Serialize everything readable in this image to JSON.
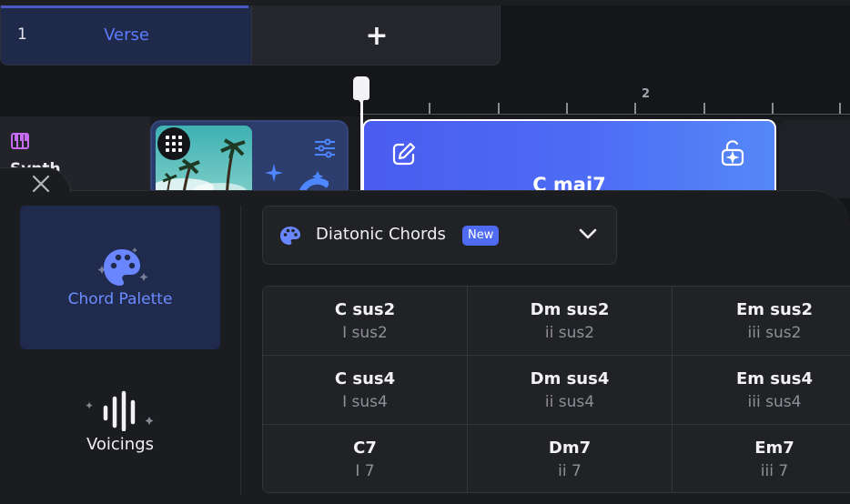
{
  "section": {
    "number": "1",
    "name": "Verse",
    "add_label": "+"
  },
  "ruler": {
    "bar_label": "2"
  },
  "track": {
    "name": "Synth"
  },
  "clip": {
    "chord": "C maj7"
  },
  "sidebar": {
    "palette_label": "Chord Palette",
    "voicings_label": "Voicings"
  },
  "dropdown": {
    "label": "Diatonic Chords",
    "badge": "New"
  },
  "chords": [
    {
      "name": "C sus2",
      "roman": "I sus2"
    },
    {
      "name": "Dm sus2",
      "roman": "ii sus2"
    },
    {
      "name": "Em sus2",
      "roman": "iii sus2"
    },
    {
      "name": "C sus4",
      "roman": "I sus4"
    },
    {
      "name": "Dm sus4",
      "roman": "ii sus4"
    },
    {
      "name": "Em sus4",
      "roman": "iii sus4"
    },
    {
      "name": "C7",
      "roman": "I 7"
    },
    {
      "name": "Dm7",
      "roman": "ii 7"
    },
    {
      "name": "Em7",
      "roman": "iii 7"
    }
  ],
  "colors": {
    "accent": "#4e6bf2",
    "clip": "#4d6cf5",
    "synth_icon": "#c76cf0"
  }
}
